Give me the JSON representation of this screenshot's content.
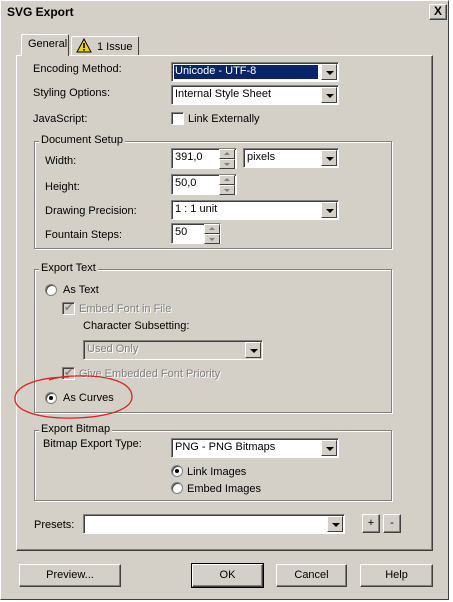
{
  "window": {
    "title": "SVG Export",
    "close_glyph": "X"
  },
  "tabs": [
    {
      "label": "General",
      "selected": true
    },
    {
      "label": "1 Issue",
      "icon": "warning-icon"
    }
  ],
  "general": {
    "encoding_label": "Encoding Method:",
    "encoding_value": "Unicode - UTF-8",
    "styling_label": "Styling Options:",
    "styling_value": "Internal Style Sheet",
    "javascript_label": "JavaScript:",
    "link_externally_label": "Link Externally"
  },
  "document_setup": {
    "legend": "Document Setup",
    "width_label": "Width:",
    "width_value": "391,0",
    "units_value": "pixels",
    "height_label": "Height:",
    "height_value": "50,0",
    "precision_label": "Drawing Precision:",
    "precision_value": "1 : 1 unit",
    "fountain_label": "Fountain Steps:",
    "fountain_value": "50"
  },
  "export_text": {
    "legend": "Export Text",
    "as_text_label": "As Text",
    "embed_font_label": "Embed Font in File",
    "subsetting_label": "Character Subsetting:",
    "subsetting_value": "Used Only",
    "give_priority_label": "Give Embedded Font Priority",
    "as_curves_label": "As Curves",
    "selected_option": "As Curves"
  },
  "export_bitmap": {
    "legend": "Export Bitmap",
    "type_label": "Bitmap Export Type:",
    "type_value": "PNG - PNG Bitmaps",
    "link_images_label": "Link Images",
    "embed_images_label": "Embed Images",
    "selected_option": "Link Images"
  },
  "presets": {
    "label": "Presets:",
    "value": "",
    "add_label": "+",
    "remove_label": "-"
  },
  "footer": {
    "preview_label": "Preview...",
    "ok_label": "OK",
    "cancel_label": "Cancel",
    "help_label": "Help"
  },
  "annotation": {
    "color": "#e02020",
    "target": "As Curves"
  },
  "colors": {
    "dialog": "#d4d0c8",
    "selection": "#0a246a",
    "warning": "#f2d400"
  }
}
